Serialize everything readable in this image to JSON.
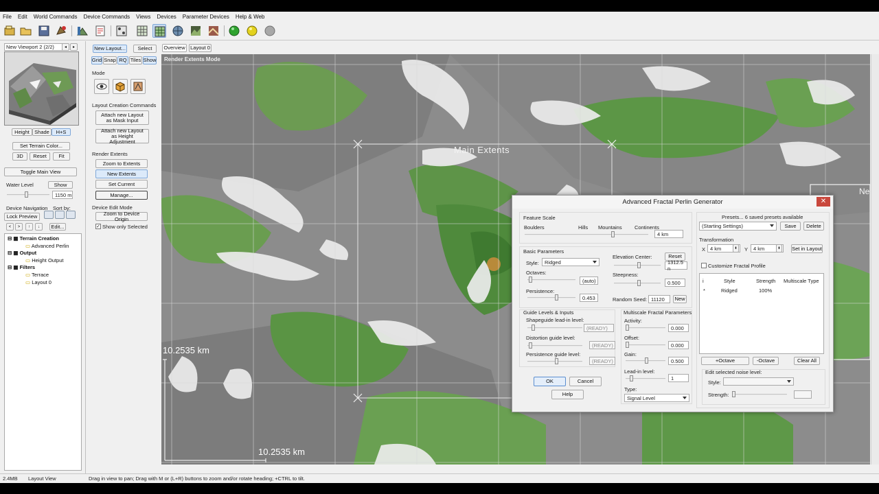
{
  "menu": [
    "File",
    "Edit",
    "World Commands",
    "Device Commands",
    "Views",
    "Devices",
    "Parameter Devices",
    "Help & Web"
  ],
  "toolbar_icons": [
    "new-world-icon",
    "open-icon",
    "save-icon",
    "run-icon",
    "build-icon",
    "scripting-icon",
    "layout-view-icon",
    "grid-view-icon",
    "active-grid-icon",
    "globe-icon",
    "terrain-icon",
    "render-icon",
    "status-green-icon",
    "status-yellow-icon",
    "status-gray-icon"
  ],
  "viewport": {
    "title": "New Viewport 2 (2/2)",
    "modes": [
      "Height",
      "Shade",
      "H+S"
    ],
    "set_terrain_color": "Set Terrain Color...",
    "btn_3d": "3D",
    "btn_reset": "Reset",
    "btn_fit": "Fit",
    "toggle_main_view": "Toggle Main View",
    "water_level_label": "Water Level",
    "water_show": "Show",
    "water_value": "1150 m",
    "device_nav_label": "Device Navigation",
    "sort_by_label": "Sort by:",
    "lock_preview": "Lock Preview",
    "edit": "Edit..."
  },
  "tree": [
    {
      "label": "Terrain Creation",
      "level": 0
    },
    {
      "label": "Advanced Perlin",
      "level": 1
    },
    {
      "label": "Output",
      "level": 0
    },
    {
      "label": "Height Output",
      "level": 1
    },
    {
      "label": "Filters",
      "level": 0
    },
    {
      "label": "Terrace",
      "level": 1
    },
    {
      "label": "Layout 0",
      "level": 1
    }
  ],
  "layout_panel": {
    "new_layout": "New Layout...",
    "select": "Select",
    "toggles": [
      "Grid",
      "Snap",
      "RQ",
      "Tiles",
      "Show"
    ],
    "mode_label": "Mode",
    "layout_commands_label": "Layout Creation Commands",
    "attach_mask": "Attach new Layout as Mask Input",
    "attach_height": "Attach new Layout as Height Adjustment",
    "render_extents_label": "Render Extents",
    "zoom_to_extents": "Zoom to Extents",
    "new_extents": "New Extents",
    "set_current": "Set Current",
    "manage": "Manage...",
    "device_edit_label": "Device Edit Mode",
    "zoom_to_origin": "Zoom to Device Origin",
    "show_only_selected": "Show only Selected"
  },
  "tabs": [
    "Overview",
    "Layout 0"
  ],
  "map": {
    "mode_label": "Render Extents Mode",
    "main_extents": "Main Extents",
    "scale_vertical": "10.2535 km",
    "scale_horizontal": "10.2535 km",
    "partial_label": "Ne"
  },
  "dialog": {
    "title": "Advanced Fractal Perlin Generator",
    "close": "✕",
    "feature_scale_label": "Feature Scale",
    "scale_words": [
      "Boulders",
      "Hills",
      "Mountains",
      "Continents"
    ],
    "scale_value": "4 km",
    "scale_level": 0.72,
    "basic_params_label": "Basic Parameters",
    "style_label": "Style:",
    "style_value": "Ridged",
    "octaves_label": "Octaves:",
    "octaves_value": "(auto)",
    "persistence_label": "Persistence:",
    "persistence_value": "0.453",
    "elevation_center_label": "Elevation Center:",
    "reset": "Reset",
    "elevation_value": "1312.5 n",
    "steepness_label": "Steepness:",
    "steepness_value": "0.500",
    "random_seed_label": "Random Seed:",
    "seed_value": "11120",
    "new_seed": "New",
    "guide_label": "Guide Levels & Inputs",
    "shapeguide_label": "Shapeguide lead-in level:",
    "shapeguide_state": "(READY)",
    "distortion_label": "Distortion guide level:",
    "distortion_state": "(READY)",
    "persistence_guide_label": "Persistence guide level:",
    "persistence_guide_state": "(READY)",
    "multiscale_label": "Multiscale Fractal Parameters",
    "activity_label": "Activity:",
    "activity_value": "0.000",
    "offset_label": "Offset:",
    "offset_value": "0.000",
    "gain_label": "Gain:",
    "gain_value": "0.500",
    "leadin_label": "Lead-in level:",
    "leadin_value": "1",
    "type_label": "Type:",
    "type_value": "Signal Level",
    "ok": "OK",
    "cancel": "Cancel",
    "help": "Help",
    "presets_label": "Presets... 6 saved presets available",
    "preset_value": "(Starting Settings)",
    "save": "Save",
    "delete": "Delete",
    "transformation_label": "Transformation",
    "x_label": "X",
    "x_value": "4 km",
    "y_label": "Y",
    "y_value": "4 km",
    "set_in_layout": "Set in Layout",
    "customize_label": "Customize Fractal Profile",
    "table_headers": [
      "i",
      "Style",
      "Strength",
      "Multiscale Type"
    ],
    "table_rows": [
      {
        "i": "*",
        "style": "Ridged",
        "strength": "100%",
        "type": ""
      }
    ],
    "add_octave": "+Octave",
    "remove_octave": "-Octave",
    "clear_all": "Clear All",
    "edit_noise_label": "Edit selected noise level:",
    "noise_style_label": "Style:",
    "noise_strength_label": "Strength:"
  },
  "status": {
    "memory": "2.4MB",
    "view": "Layout View",
    "hint": "Drag in view to pan; Drag with M or (L+R) buttons to zoom and/or rotate heading; +CTRL to tilt."
  },
  "colors": {
    "accent_blue": "#dceafa",
    "terrain_green": "#5f9a4a",
    "terrain_gray": "#8a8a8a",
    "close_red": "#c9483d"
  }
}
